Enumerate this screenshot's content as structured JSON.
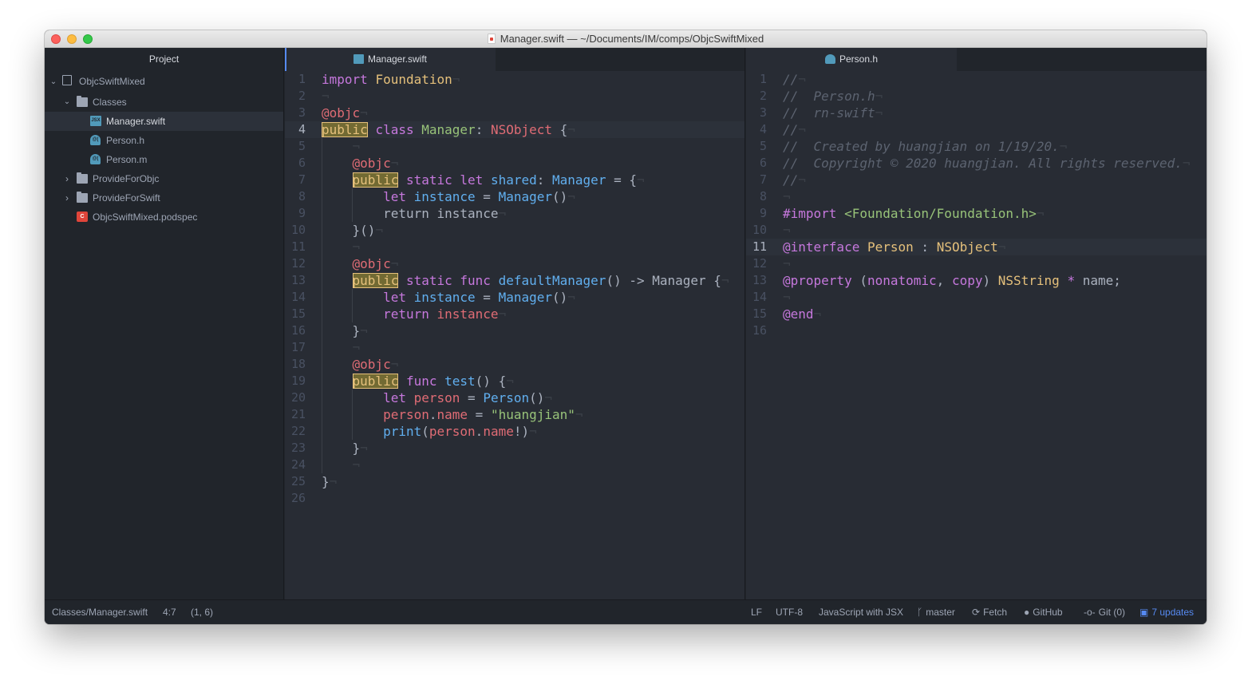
{
  "window": {
    "title": "Manager.swift — ~/Documents/IM/comps/ObjcSwiftMixed"
  },
  "sidebar": {
    "header": "Project",
    "items": [
      {
        "label": "ObjcSwiftMixed",
        "icon": "repo-icon",
        "expanded": true
      },
      {
        "label": "Classes",
        "icon": "folder-icon",
        "expanded": true
      },
      {
        "label": "Manager.swift",
        "icon": "swift-file-icon",
        "selected": true
      },
      {
        "label": "Person.h",
        "icon": "objc-file-icon"
      },
      {
        "label": "Person.m",
        "icon": "objc-file-icon"
      },
      {
        "label": "ProvideForObjc",
        "icon": "folder-icon",
        "expanded": false
      },
      {
        "label": "ProvideForSwift",
        "icon": "folder-icon",
        "expanded": false
      },
      {
        "label": "ObjcSwiftMixed.podspec",
        "icon": "podspec-file-icon"
      }
    ]
  },
  "left_pane": {
    "tab_label": "Manager.swift",
    "line_numbers": [
      "1",
      "2",
      "3",
      "4",
      "5",
      "6",
      "7",
      "8",
      "9",
      "10",
      "11",
      "12",
      "13",
      "14",
      "15",
      "16",
      "17",
      "18",
      "19",
      "20",
      "21",
      "22",
      "23",
      "24",
      "25",
      "26"
    ],
    "tokens": {
      "import": "import",
      "foundation": "Foundation",
      "objc": "@objc",
      "public": "public",
      "class": "class",
      "manager": "Manager",
      "nsobject": "NSObject",
      "static": "static",
      "let": "let",
      "shared": "shared",
      "func": "func",
      "default_manager": "defaultManager",
      "instance": "instance",
      "return": "return",
      "test": "test",
      "person_var": "person",
      "person_type": "Person",
      "name": "name",
      "huangjian": "\"huangjian\"",
      "print": "print"
    }
  },
  "right_pane": {
    "tab_label": "Person.h",
    "line_numbers": [
      "1",
      "2",
      "3",
      "4",
      "5",
      "6",
      "7",
      "8",
      "9",
      "10",
      "11",
      "12",
      "13",
      "14",
      "15",
      "16"
    ],
    "comments": [
      "//",
      "//  Person.h",
      "//  rn-swift",
      "//",
      "//  Created by huangjian on 1/19/20.",
      "//  Copyright © 2020 huangjian. All rights reserved.",
      "//"
    ],
    "tokens": {
      "import_directive": "#import",
      "import_path": "<Foundation/Foundation.h>",
      "interface": "@interface",
      "person": "Person",
      "colon": ":",
      "nsobject": "NSObject",
      "property": "@property",
      "nonatomic": "nonatomic",
      "copy": "copy",
      "nsstring": "NSString",
      "star": "*",
      "name": "name;",
      "end": "@end"
    }
  },
  "statusbar": {
    "file_path": "Classes/Manager.swift",
    "cursor": "4:7",
    "selection": "(1, 6)",
    "line_ending": "LF",
    "encoding": "UTF-8",
    "grammar": "JavaScript with JSX",
    "branch": "master",
    "fetch": "Fetch",
    "github": "GitHub",
    "git": "Git (0)",
    "updates": "7 updates"
  },
  "colors": {
    "accent": "#568af2",
    "background": "#282c34",
    "panel": "#21252b",
    "keyword": "#c678dd",
    "type": "#e5c07b",
    "function": "#61afef",
    "string": "#98c379",
    "variable": "#e06c75",
    "comment": "#5c6370"
  }
}
